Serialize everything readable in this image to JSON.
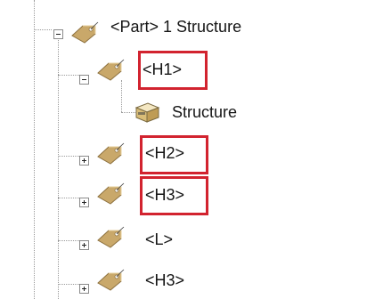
{
  "tree": {
    "root": {
      "label": "<Part> 1 Structure",
      "expanded": true,
      "icon": "tag-icon"
    },
    "children": [
      {
        "label": "<H1>",
        "expanded": true,
        "icon": "tag-icon",
        "highlighted": true,
        "children": [
          {
            "label": "Structure",
            "icon": "structure-box-icon"
          }
        ]
      },
      {
        "label": "<H2>",
        "expanded": false,
        "icon": "tag-icon",
        "highlighted": true
      },
      {
        "label": "<H3>",
        "expanded": false,
        "icon": "tag-icon",
        "highlighted": true
      },
      {
        "label": "<L>",
        "expanded": false,
        "icon": "tag-icon"
      },
      {
        "label": "<H3>",
        "expanded": false,
        "icon": "tag-icon"
      }
    ]
  },
  "colors": {
    "highlight": "#d2232f",
    "tag_fill": "#c9a86a",
    "tree_line": "#9a9a9a",
    "background": "#ffffff"
  }
}
